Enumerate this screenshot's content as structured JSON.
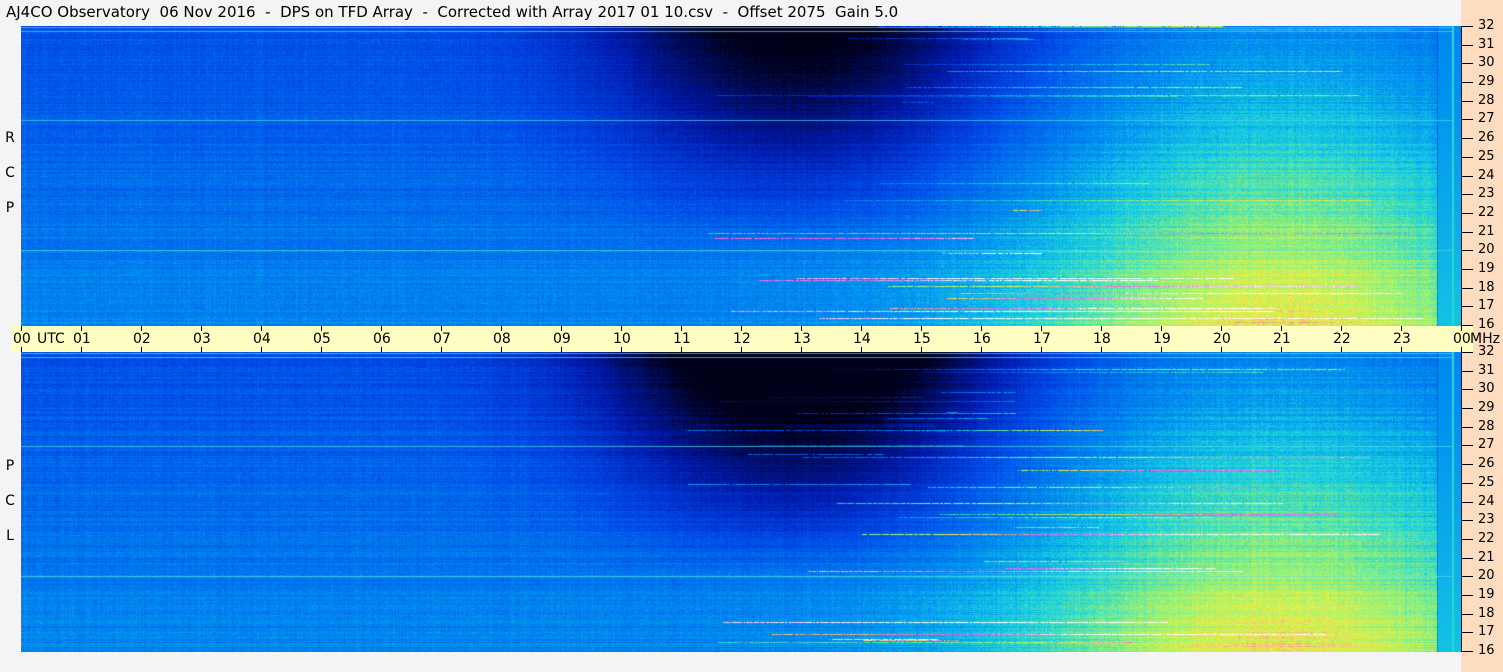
{
  "title": "AJ4CO Observatory  06 Nov 2016  -  DPS on TFD Array  -  Corrected with Array 2017 01 10.csv  -  Offset 2075  Gain 5.0",
  "panels": {
    "top": [
      "R",
      "C",
      "P"
    ],
    "bottom": [
      "L",
      "C",
      "P"
    ]
  },
  "axis": {
    "utc_label": "UTC",
    "mhz_label": "MHz",
    "time_ticks": [
      "00",
      "01",
      "02",
      "03",
      "04",
      "05",
      "06",
      "07",
      "08",
      "09",
      "10",
      "11",
      "12",
      "13",
      "14",
      "15",
      "16",
      "17",
      "18",
      "19",
      "20",
      "21",
      "22",
      "23",
      "00"
    ],
    "freq_ticks": [
      "32",
      "31",
      "30",
      "29",
      "28",
      "27",
      "26",
      "25",
      "24",
      "23",
      "22",
      "21",
      "20",
      "19",
      "18",
      "17",
      "16"
    ]
  },
  "chart_data": {
    "type": "heatmap",
    "title": "AJ4CO Observatory 06 Nov 2016 - DPS on TFD Array",
    "xlabel": "UTC",
    "ylabel": "MHz",
    "xlim": [
      0,
      24
    ],
    "ylim": [
      16,
      32
    ],
    "series": [
      {
        "name": "RCP"
      },
      {
        "name": "LCP"
      }
    ],
    "colormap": [
      "#000018",
      "#0018a8",
      "#0048e8",
      "#0090f0",
      "#18d0e0",
      "#88f080",
      "#f0f040",
      "#ff40ff",
      "#ffffff"
    ],
    "features": {
      "quiet_dark_hours": [
        9,
        17
      ],
      "daytime_emission_hours": [
        11.5,
        23.6
      ],
      "emission_peak_hour": 21
    }
  }
}
